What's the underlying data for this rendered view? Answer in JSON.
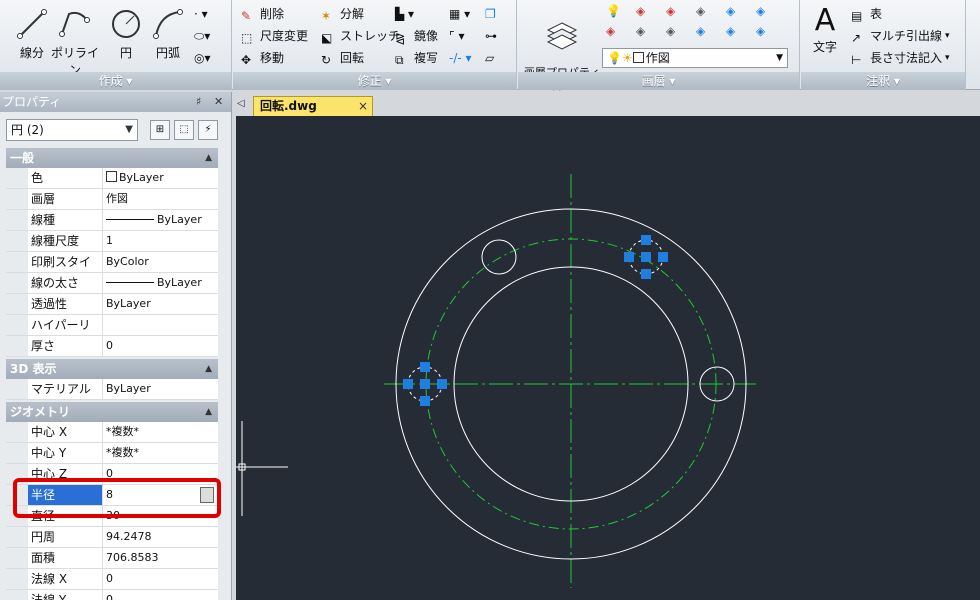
{
  "ribbon": {
    "create": {
      "title": "作成 ▾",
      "line": "線分",
      "polyline": "ポリライン",
      "circle": "円",
      "arc": "円弧"
    },
    "modify": {
      "title": "修正 ▾",
      "erase": "削除",
      "explode": "分解",
      "scale": "尺度変更",
      "stretch": "ストレッチ",
      "mirror": "鏡像",
      "move": "移動",
      "rotate": "回転",
      "copy": "複写"
    },
    "layers": {
      "title": "画層 ▾",
      "layer_properties": "画層プロパティ\n管理",
      "current_layer": "作図"
    },
    "annotation": {
      "title": "注釈 ▾",
      "text": "文字",
      "table": "表",
      "mleader": "マルチ引出線",
      "linear_dim": "長さ寸法記入"
    }
  },
  "palette": {
    "title": "プロパティ",
    "object_select": "円 (2)",
    "sections": {
      "general": "一般",
      "three_d": "3D 表示",
      "geometry": "ジオメトリ"
    },
    "general_rows": [
      {
        "name": "色",
        "value": "ByLayer"
      },
      {
        "name": "画層",
        "value": "作図"
      },
      {
        "name": "線種",
        "value": "ByLayer"
      },
      {
        "name": "線種尺度",
        "value": "1"
      },
      {
        "name": "印刷スタイル",
        "value": "ByColor"
      },
      {
        "name": "線の太さ",
        "value": "ByLayer"
      },
      {
        "name": "透過性",
        "value": "ByLayer"
      },
      {
        "name": "ハイパーリンク",
        "value": ""
      },
      {
        "name": "厚さ",
        "value": "0"
      }
    ],
    "three_d_rows": [
      {
        "name": "マテリアル",
        "value": "ByLayer"
      }
    ],
    "geometry_rows": [
      {
        "name": "中心 X",
        "value": "*複数*"
      },
      {
        "name": "中心 Y",
        "value": "*複数*"
      },
      {
        "name": "中心 Z",
        "value": "0"
      },
      {
        "name": "半径",
        "value": "8"
      },
      {
        "name": "直径",
        "value": "30"
      },
      {
        "name": "円周",
        "value": "94.2478"
      },
      {
        "name": "面積",
        "value": "706.8583"
      },
      {
        "name": "法線 X",
        "value": "0"
      },
      {
        "name": "法線 Y",
        "value": "0"
      }
    ]
  },
  "document": {
    "tab_name": "回転.dwg",
    "close": "×"
  },
  "colors": {
    "canvas_bg": "#252c36",
    "centerline": "#22c833",
    "geometry": "#ffffff",
    "grip": "#1f7fe0",
    "highlight": "#e10000"
  }
}
